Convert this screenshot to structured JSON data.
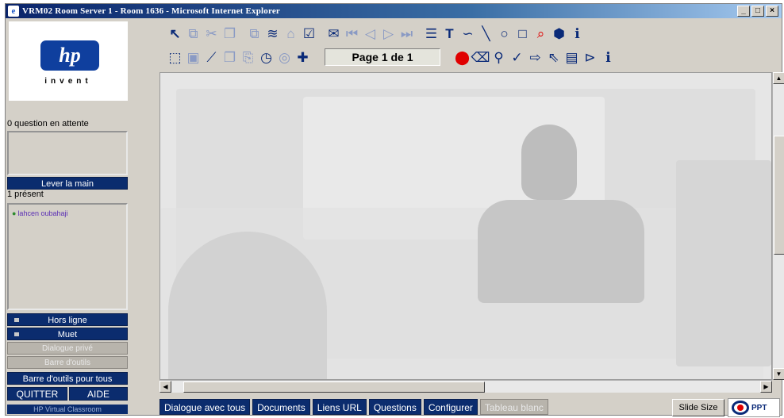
{
  "window": {
    "title": "VRM02 Room Server 1 - Room 1636 - Microsoft Internet Explorer",
    "controls": {
      "minimize": "_",
      "maximize": "□",
      "close": "×"
    }
  },
  "logo": {
    "brand": "hp",
    "tagline": "invent"
  },
  "left_panel": {
    "questions_waiting": "0 question en attente",
    "raise_hand": "Lever la main",
    "present_count": "1 présent",
    "participants": [
      "lahcen oubahaji"
    ],
    "offline": "Hors ligne",
    "mute": "Muet",
    "private_dialog": "Dialogue privé",
    "toolbar_btn": "Barre d'outils",
    "toolbar_for_all": "Barre d'outils pour tous",
    "quit": "QUITTER",
    "help": "AIDE",
    "footer": "HP Virtual Classroom"
  },
  "toolbar": {
    "page_indicator": "Page 1 de 1",
    "row1_icons": [
      {
        "name": "pointer-icon",
        "glyph": "↖",
        "style": "bold"
      },
      {
        "name": "copy-icon",
        "glyph": "⧉",
        "style": "faint"
      },
      {
        "name": "cut-icon",
        "glyph": "✂",
        "style": "faint"
      },
      {
        "name": "paste-icon",
        "glyph": "❐",
        "style": "faint"
      },
      {
        "name": "clone-icon",
        "glyph": "⧉",
        "style": "faint"
      },
      {
        "name": "stack-icon",
        "glyph": "≋",
        "style": ""
      },
      {
        "name": "sync-icon",
        "glyph": "⌂",
        "style": "faint"
      },
      {
        "name": "checkbox-icon",
        "glyph": "☑",
        "style": ""
      },
      {
        "name": "open-folder-icon",
        "glyph": "✉",
        "style": ""
      },
      {
        "name": "first-page-icon",
        "glyph": "⏮",
        "style": "faint"
      },
      {
        "name": "prev-page-icon",
        "glyph": "◁",
        "style": "faint"
      },
      {
        "name": "next-page-icon",
        "glyph": "▷",
        "style": "faint"
      },
      {
        "name": "last-page-icon",
        "glyph": "⏭",
        "style": "faint"
      },
      {
        "name": "line-weight-icon",
        "glyph": "☰",
        "style": ""
      },
      {
        "name": "text-tool-icon",
        "glyph": "T",
        "style": "bold"
      },
      {
        "name": "freehand-icon",
        "glyph": "∽",
        "style": ""
      },
      {
        "name": "line-tool-icon",
        "glyph": "╲",
        "style": ""
      },
      {
        "name": "ellipse-tool-icon",
        "glyph": "○",
        "style": ""
      },
      {
        "name": "rect-tool-icon",
        "glyph": "□",
        "style": ""
      },
      {
        "name": "zoom-tool-icon",
        "glyph": "⌕",
        "style": "red"
      },
      {
        "name": "cube-icon",
        "glyph": "⬢",
        "style": ""
      },
      {
        "name": "info-icon",
        "glyph": "ℹ",
        "style": ""
      }
    ],
    "row2_icons_left": [
      {
        "name": "select-area-icon",
        "glyph": "⬚",
        "style": ""
      },
      {
        "name": "sticky-icon",
        "glyph": "▣",
        "style": "faint"
      },
      {
        "name": "marker-icon",
        "glyph": "⟋",
        "style": ""
      },
      {
        "name": "window-icon",
        "glyph": "❐",
        "style": "faint"
      },
      {
        "name": "paste-alt-icon",
        "glyph": "⎘",
        "style": "faint"
      },
      {
        "name": "timer-icon",
        "glyph": "◷",
        "style": ""
      },
      {
        "name": "chat-bubble-icon",
        "glyph": "◎",
        "style": "faint"
      },
      {
        "name": "add-icon",
        "glyph": "✚",
        "style": ""
      }
    ],
    "row2_icons_right": [
      {
        "name": "record-icon",
        "glyph": "⬤",
        "style": "red"
      },
      {
        "name": "eraser-icon",
        "glyph": "⌫",
        "style": ""
      },
      {
        "name": "magnifier-icon",
        "glyph": "⚲",
        "style": ""
      },
      {
        "name": "check-icon",
        "glyph": "✓",
        "style": ""
      },
      {
        "name": "arrow-right-icon",
        "glyph": "⇨",
        "style": ""
      },
      {
        "name": "cursor-arrow-icon",
        "glyph": "⇖",
        "style": ""
      },
      {
        "name": "document-icon",
        "glyph": "▤",
        "style": ""
      },
      {
        "name": "export-icon",
        "glyph": "⊳",
        "style": ""
      },
      {
        "name": "info-alt-icon",
        "glyph": "ℹ",
        "style": ""
      }
    ]
  },
  "scroll": {
    "up": "▲",
    "down": "▼",
    "left": "◀",
    "right": "▶"
  },
  "tabs": [
    {
      "label": "Dialogue avec tous",
      "active": true
    },
    {
      "label": "Documents",
      "active": true
    },
    {
      "label": "Liens URL",
      "active": true
    },
    {
      "label": "Questions",
      "active": true
    },
    {
      "label": "Configurer",
      "active": true
    },
    {
      "label": "Tableau blanc",
      "active": false
    }
  ],
  "slide_size": "Slide Size",
  "ppt_label": "PPT"
}
